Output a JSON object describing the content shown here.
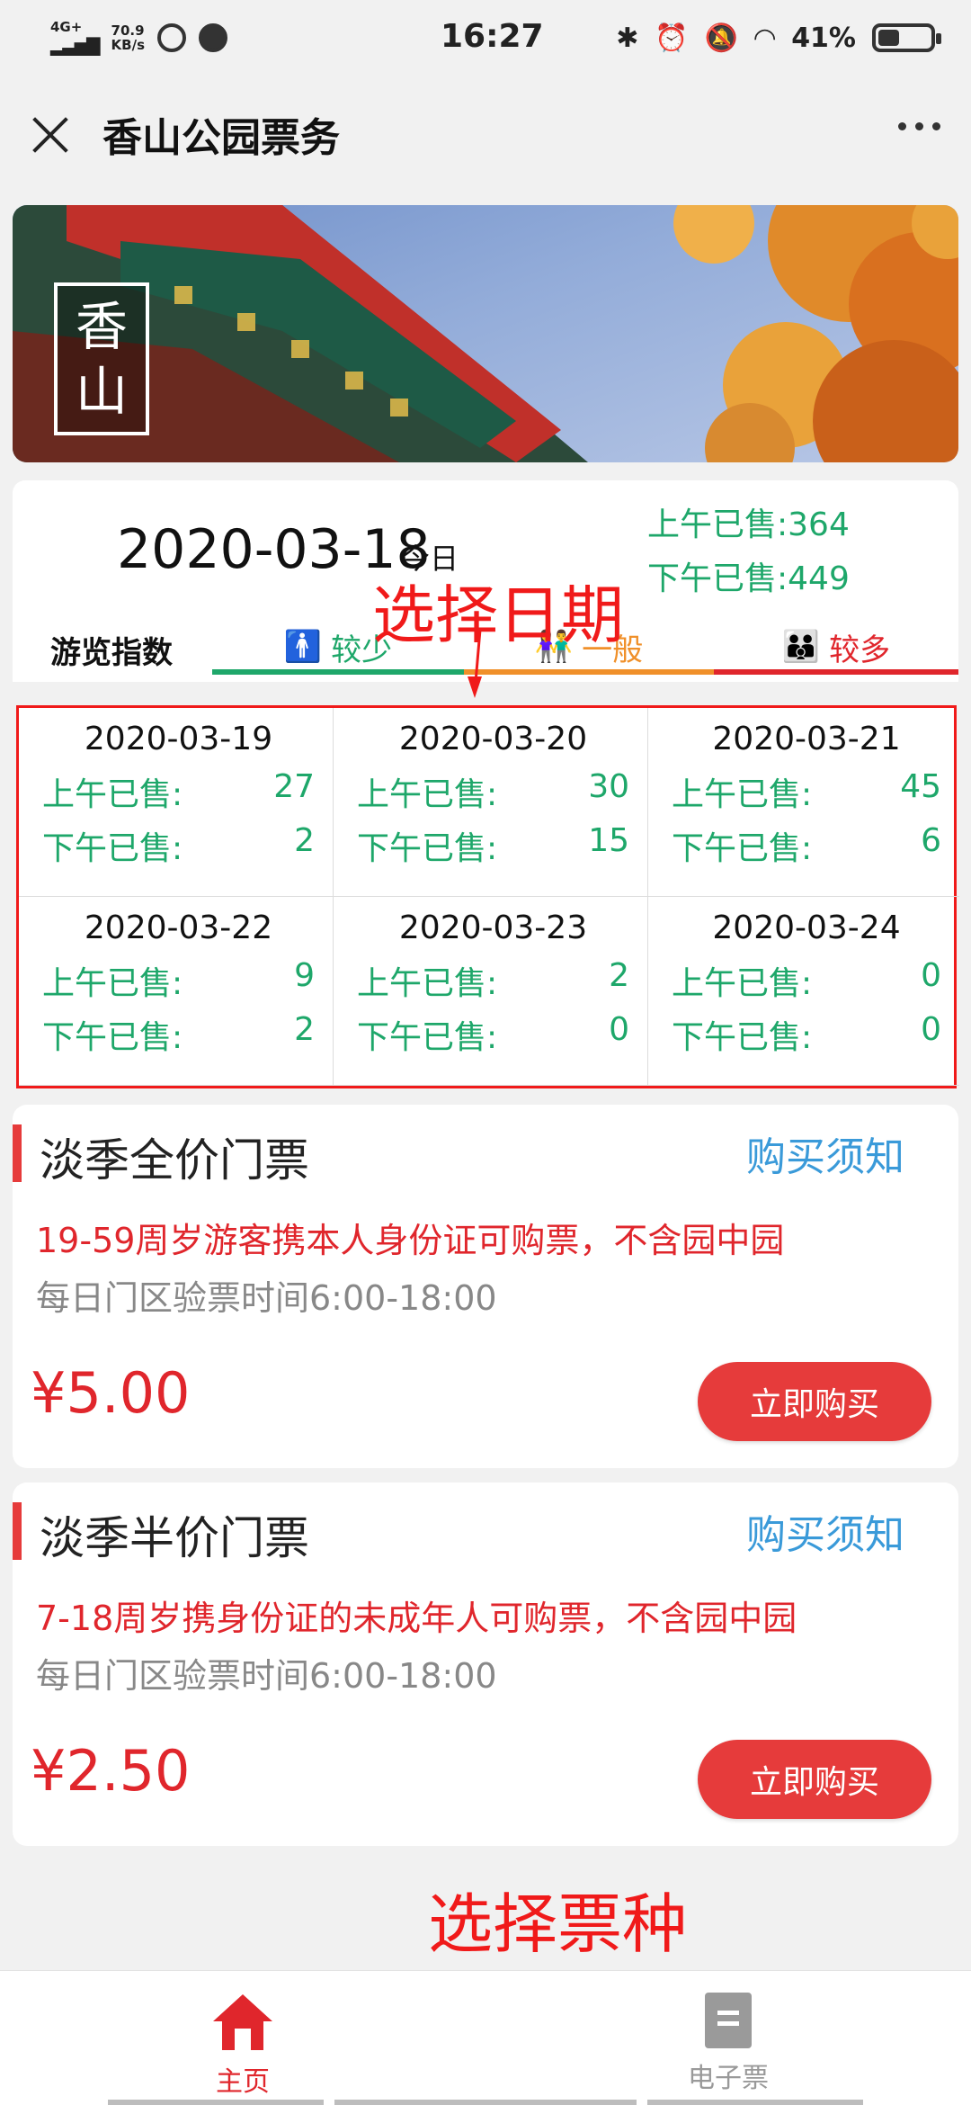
{
  "status_bar": {
    "network": "4G+",
    "speed_value": "70.9",
    "speed_unit": "KB/s",
    "time": "16:27",
    "battery": "41%",
    "battery_level": 0.41
  },
  "header": {
    "title": "香山公园票务"
  },
  "banner": {
    "seal_char_1": "香",
    "seal_char_2": "山"
  },
  "today": {
    "date": "2020-03-18",
    "tag": "今日",
    "am_sold": "上午已售:364",
    "pm_sold": "下午已售:449"
  },
  "crowd_index": {
    "label": "游览指数",
    "levels": [
      {
        "label": "较少",
        "color": "#1ea76a"
      },
      {
        "label": "一般",
        "color": "#f0902a"
      },
      {
        "label": "较多",
        "color": "#e0262c"
      }
    ]
  },
  "annotations": {
    "select_date": "选择日期",
    "select_ticket_type": "选择票种"
  },
  "date_grid": {
    "am_label": "上午已售:",
    "pm_label": "下午已售:",
    "days": [
      {
        "date": "2020-03-19",
        "am": "27",
        "pm": "2"
      },
      {
        "date": "2020-03-20",
        "am": "30",
        "pm": "15"
      },
      {
        "date": "2020-03-21",
        "am": "45",
        "pm": "6"
      },
      {
        "date": "2020-03-22",
        "am": "9",
        "pm": "2"
      },
      {
        "date": "2020-03-23",
        "am": "2",
        "pm": "0"
      },
      {
        "date": "2020-03-24",
        "am": "0",
        "pm": "0"
      }
    ]
  },
  "tickets": [
    {
      "name": "淡季全价门票",
      "notice": "购买须知",
      "desc": "19-59周岁游客携本人身份证可购票，不含园中园",
      "hours": "每日门区验票时间6:00-18:00",
      "price": "¥5.00",
      "buy": "立即购买"
    },
    {
      "name": "淡季半价门票",
      "notice": "购买须知",
      "desc": "7-18周岁携身份证的未成年人可购票，不含园中园",
      "hours": "每日门区验票时间6:00-18:00",
      "price": "¥2.50",
      "buy": "立即购买"
    }
  ],
  "bottom_nav": {
    "home": "主页",
    "eticket": "电子票"
  },
  "colors": {
    "accent_red": "#e0262c",
    "sold_green": "#1ea76a",
    "notice_blue": "#3a9ad9",
    "annotation_red": "#f01a1a"
  }
}
